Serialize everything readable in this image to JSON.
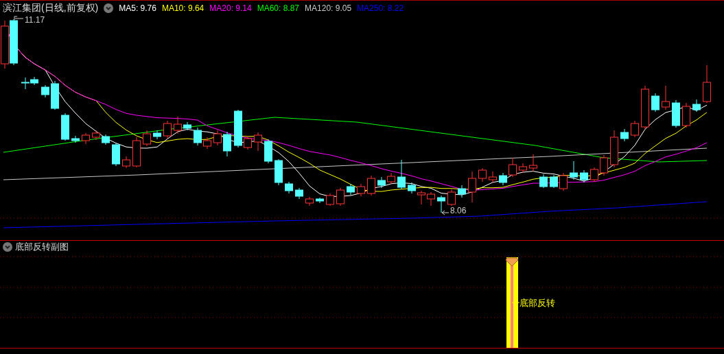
{
  "header": {
    "title": "滨江集团(日线,前复权)",
    "indicators": [
      {
        "label": "MA5: 9.76",
        "color": "#ffffff"
      },
      {
        "label": "MA10: 9.64",
        "color": "#ffff00"
      },
      {
        "label": "MA20: 9.14",
        "color": "#ff00ff"
      },
      {
        "label": "MA60: 8.87",
        "color": "#00ff00"
      },
      {
        "label": "MA120: 9.05",
        "color": "#c8c8c8"
      },
      {
        "label": "MA250: 8.22",
        "color": "#0000ff"
      }
    ]
  },
  "price_chart": {
    "high_label": "11.17",
    "low_label": "8.06"
  },
  "sub_panel": {
    "title": "底部反转副图",
    "signal_label": "底部反转"
  }
}
